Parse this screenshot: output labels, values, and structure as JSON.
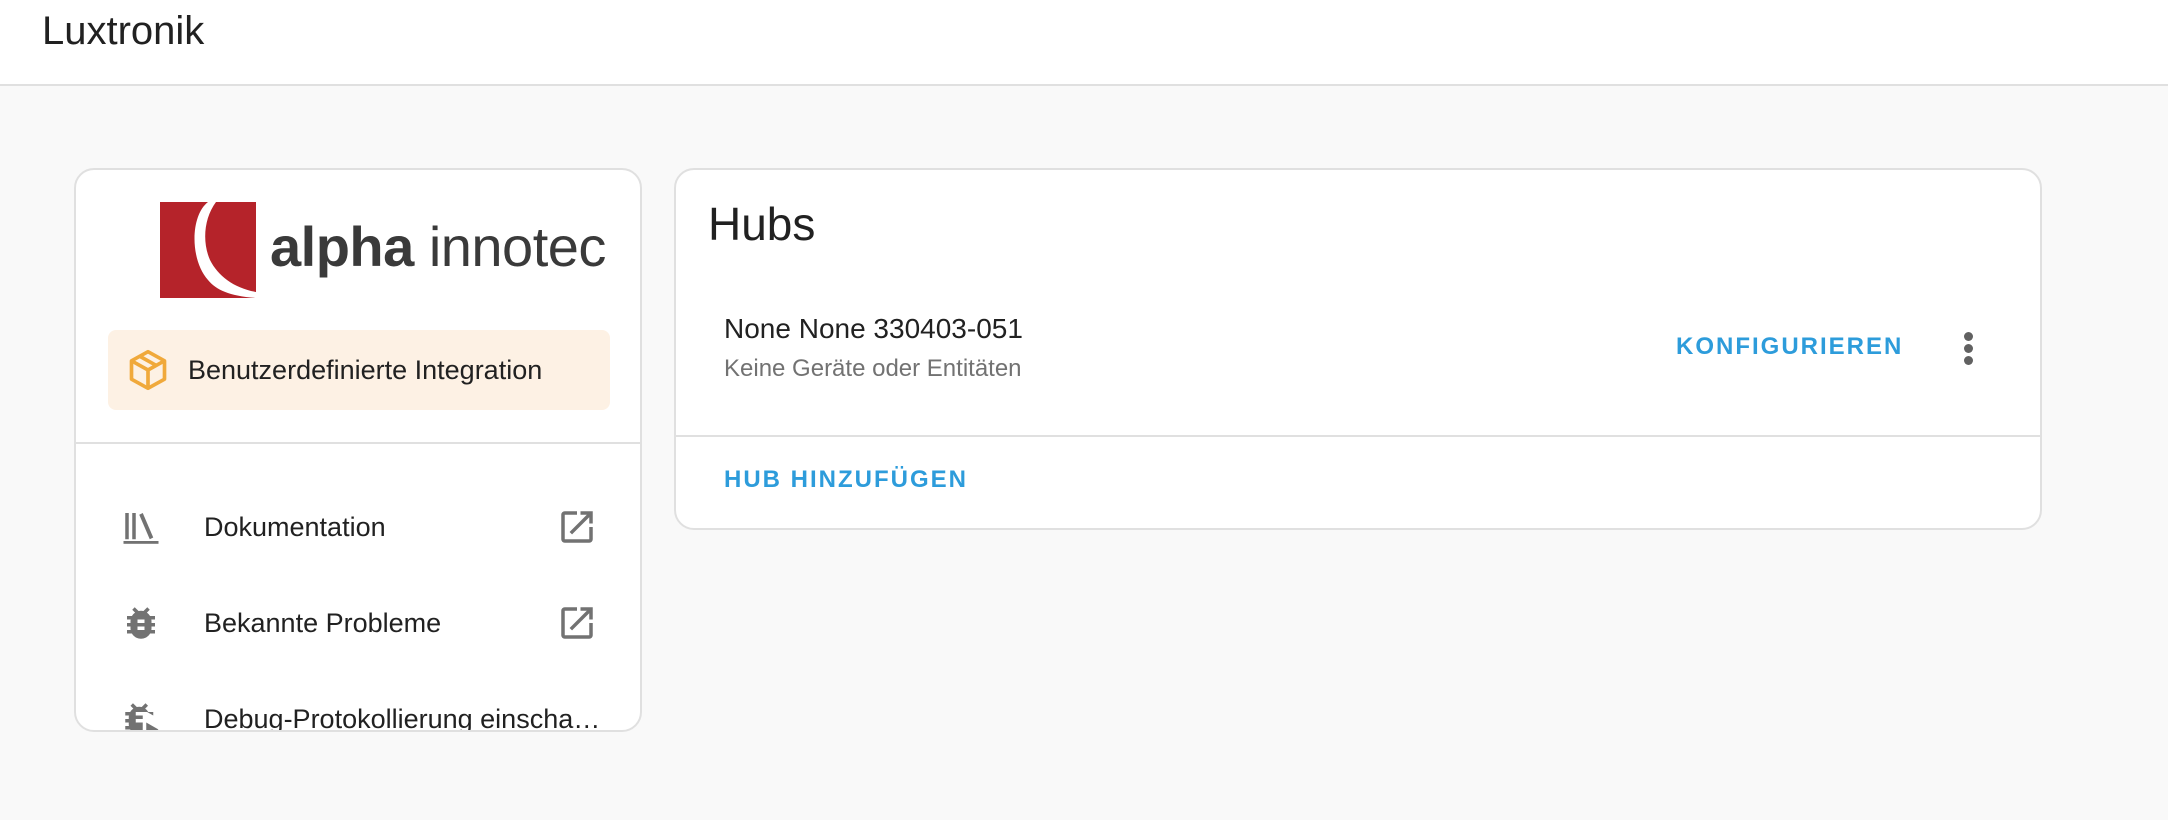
{
  "header": {
    "title": "Luxtronik"
  },
  "integration": {
    "brand_logo_text_bold": "alpha",
    "brand_logo_text_light": "innotec",
    "custom_badge_label": "Benutzerdefinierte Integration",
    "links": [
      {
        "label": "Dokumentation",
        "icon": "book-shelf-icon",
        "external": true
      },
      {
        "label": "Bekannte Probleme",
        "icon": "bug-icon",
        "external": true
      },
      {
        "label": "Debug-Protokollierung einschalten",
        "icon": "bug-play-icon",
        "external": false
      }
    ]
  },
  "hubs": {
    "title": "Hubs",
    "entries": [
      {
        "name": "None None 330403-051",
        "subtitle": "Keine Geräte oder Entitäten",
        "configure_label": "KONFIGURIEREN"
      }
    ],
    "add_hub_label": "HUB HINZUFÜGEN"
  },
  "colors": {
    "accent": "#2d9cdb",
    "brand_red": "#b5232a",
    "custom_badge_bg": "#fdf1e4",
    "custom_badge_icon": "#f0a93b"
  }
}
